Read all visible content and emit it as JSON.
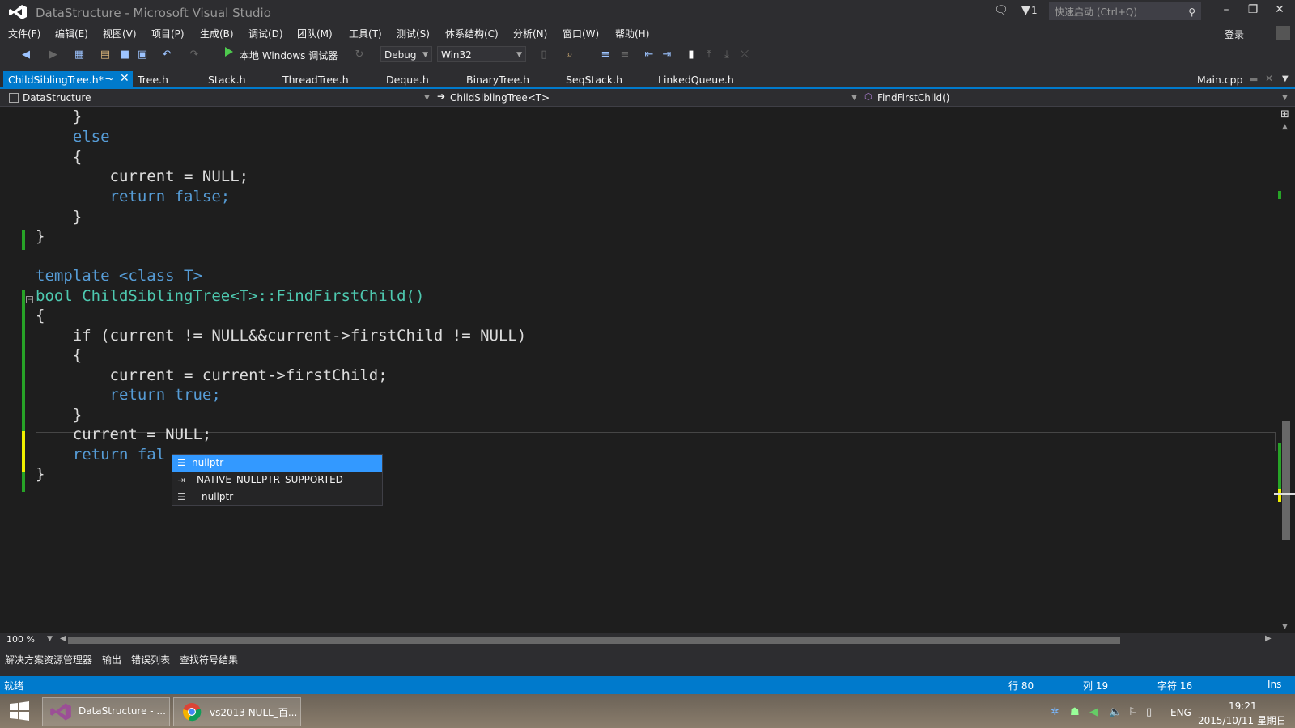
{
  "window": {
    "title": "DataStructure - Microsoft Visual Studio",
    "notification_count": "1",
    "quick_launch_placeholder": "快速启动 (Ctrl+Q)",
    "login_label": "登录"
  },
  "menu": [
    "文件(F)",
    "编辑(E)",
    "视图(V)",
    "项目(P)",
    "生成(B)",
    "调试(D)",
    "团队(M)",
    "工具(T)",
    "测试(S)",
    "体系结构(C)",
    "分析(N)",
    "窗口(W)",
    "帮助(H)"
  ],
  "toolbar": {
    "run_label": "本地 Windows 调试器",
    "config": "Debug",
    "platform": "Win32"
  },
  "tabs": [
    {
      "label": "ChildSiblingTree.h*",
      "active": true
    },
    {
      "label": "Tree.h"
    },
    {
      "label": "Stack.h"
    },
    {
      "label": "ThreadTree.h"
    },
    {
      "label": "Deque.h"
    },
    {
      "label": "BinaryTree.h"
    },
    {
      "label": "SeqStack.h"
    },
    {
      "label": "LinkedQueue.h"
    },
    {
      "label": "Main.cpp"
    }
  ],
  "navbar": {
    "project": "DataStructure",
    "scope": "ChildSiblingTree<T>",
    "member": "FindFirstChild()"
  },
  "code_lines": [
    "    }",
    "    else",
    "    {",
    "        current = NULL;",
    "        return false;",
    "    }",
    "}",
    "",
    "template <class T>",
    "bool ChildSiblingTree<T>::FindFirstChild()",
    "{",
    "    if (current != NULL&&current->firstChild != NULL)",
    "    {",
    "        current = current->firstChild;",
    "        return true;",
    "    }",
    "    current = NULL;",
    "    return fal",
    "}"
  ],
  "autocomplete": [
    {
      "label": "nullptr",
      "selected": true
    },
    {
      "label": "_NATIVE_NULLPTR_SUPPORTED"
    },
    {
      "label": "__nullptr"
    }
  ],
  "zoom": "100 %",
  "bottom_tabs": [
    "解决方案资源管理器",
    "输出",
    "错误列表",
    "查找符号结果"
  ],
  "status": {
    "state": "就绪",
    "line": "行 80",
    "col": "列 19",
    "char": "字符 16",
    "mode": "Ins"
  },
  "taskbar": {
    "apps": [
      "DataStructure - ...",
      "vs2013 NULL_百..."
    ],
    "lang": "ENG",
    "time": "19:21",
    "date": "2015/10/11 星期日"
  },
  "colors": {
    "accent": "#007acc",
    "keyword": "#569cd6",
    "type": "#4ec9b0",
    "selection": "#3399ff"
  }
}
